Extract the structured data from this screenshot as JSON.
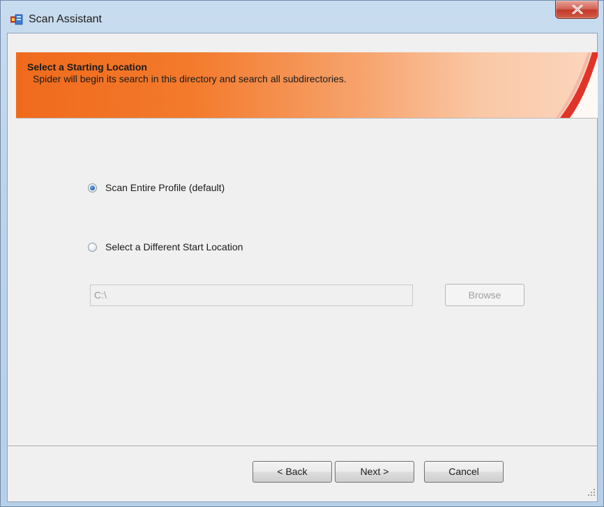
{
  "window": {
    "title": "Scan Assistant"
  },
  "banner": {
    "heading": "Select a Starting Location",
    "subtitle": "Spider will begin its search in this directory and search all subdirectories."
  },
  "options": {
    "entire_profile_label": "Scan Entire Profile (default)",
    "different_location_label": "Select a Different Start Location",
    "selected": "entire_profile"
  },
  "path_field": {
    "value": "C:\\",
    "enabled": false
  },
  "buttons": {
    "browse": "Browse",
    "back": "< Back",
    "next": "Next >",
    "cancel": "Cancel"
  },
  "colors": {
    "banner_start": "#f06a1c",
    "banner_end": "#fbd6bd",
    "radio_selected": "#2d6fb8",
    "close_button": "#c43a2a"
  },
  "icons": {
    "app": "app-icon",
    "close": "close-icon",
    "banner_decoration": "swoosh-decoration",
    "resize_grip": "resize-grip-icon"
  }
}
